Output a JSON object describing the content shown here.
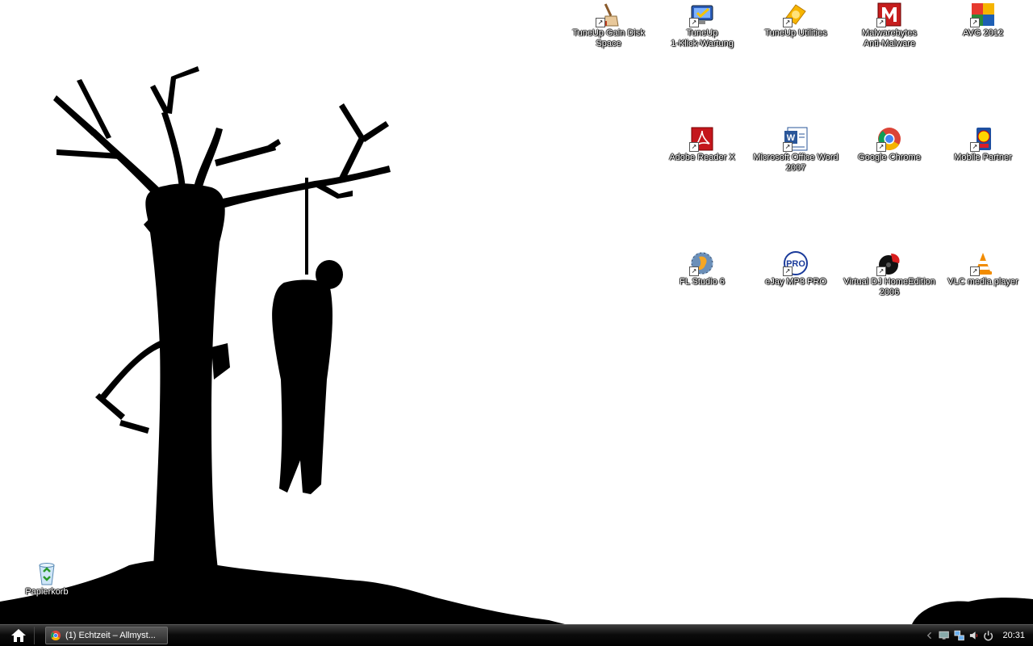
{
  "desktop": {
    "icons": [
      {
        "label": "TuneUp Gain Disk\nSpace",
        "icon": "broom-icon"
      },
      {
        "label": "TuneUp\n1-Klick-Wartung",
        "icon": "monitor-check-icon"
      },
      {
        "label": "TuneUp Utilities",
        "icon": "tuneup-icon"
      },
      {
        "label": "Malwarebytes\nAnti-Malware",
        "icon": "malwarebytes-icon"
      },
      {
        "label": "AVG 2012",
        "icon": "avg-icon"
      },
      {
        "label": "Adobe Reader X",
        "icon": "adobe-reader-icon"
      },
      {
        "label": "Microsoft Office Word\n2007",
        "icon": "word-icon"
      },
      {
        "label": "Google Chrome",
        "icon": "chrome-icon"
      },
      {
        "label": "Mobile Partner",
        "icon": "lidl-mobile-icon"
      },
      {
        "label": "FL Studio 6",
        "icon": "fl-studio-icon"
      },
      {
        "label": "eJay MP3 PRO",
        "icon": "ejay-pro-icon"
      },
      {
        "label": "Virtual DJ HomeEdition\n2006",
        "icon": "virtual-dj-icon"
      },
      {
        "label": "VLC media player",
        "icon": "vlc-icon"
      }
    ],
    "recycle_bin": {
      "label": "Papierkorb",
      "icon": "recycle-bin-icon"
    }
  },
  "taskbar": {
    "start_icon": "home-icon",
    "tasks": [
      {
        "label": "(1) Echtzeit – Allmyst...",
        "icon": "chrome-icon"
      }
    ],
    "tray": {
      "icons": [
        "chevron-left-icon",
        "monitor-icon",
        "network-icon",
        "volume-icon",
        "power-icon"
      ],
      "clock": "20:31"
    }
  },
  "colors": {
    "taskbar": "#000000",
    "desktop_background": "#ffffff",
    "icon_label": "#ffffff"
  }
}
